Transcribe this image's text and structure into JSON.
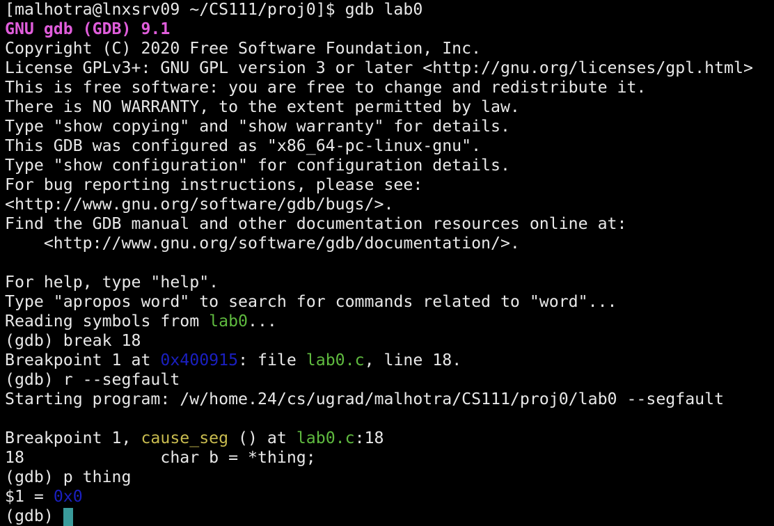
{
  "colors": {
    "background": "#000000",
    "default": "#e8e8e8",
    "banner": "#e05ddb",
    "filename": "#5fba3f",
    "function": "#c8bb4f",
    "address": "#1a1fbf",
    "cursor": "#3a9b9b"
  },
  "terminal": {
    "lines": [
      [
        {
          "t": "[malhotra@lnxsrv09 ~/CS111/proj0]$ gdb lab0"
        }
      ],
      [
        {
          "t": "GNU gdb (GDB) 9.1",
          "c": "banner",
          "b": true
        }
      ],
      [
        {
          "t": "Copyright (C) 2020 Free Software Foundation, Inc."
        }
      ],
      [
        {
          "t": "License GPLv3+: GNU GPL version 3 or later <http://gnu.org/licenses/gpl.html>"
        }
      ],
      [
        {
          "t": "This is free software: you are free to change and redistribute it."
        }
      ],
      [
        {
          "t": "There is NO WARRANTY, to the extent permitted by law."
        }
      ],
      [
        {
          "t": "Type \"show copying\" and \"show warranty\" for details."
        }
      ],
      [
        {
          "t": "This GDB was configured as \"x86_64-pc-linux-gnu\"."
        }
      ],
      [
        {
          "t": "Type \"show configuration\" for configuration details."
        }
      ],
      [
        {
          "t": "For bug reporting instructions, please see:"
        }
      ],
      [
        {
          "t": "<http://www.gnu.org/software/gdb/bugs/>."
        }
      ],
      [
        {
          "t": "Find the GDB manual and other documentation resources online at:"
        }
      ],
      [
        {
          "t": "    <http://www.gnu.org/software/gdb/documentation/>."
        }
      ],
      [
        {
          "t": ""
        }
      ],
      [
        {
          "t": "For help, type \"help\"."
        }
      ],
      [
        {
          "t": "Type \"apropos word\" to search for commands related to \"word\"..."
        }
      ],
      [
        {
          "t": "Reading symbols from "
        },
        {
          "t": "lab0",
          "c": "filename"
        },
        {
          "t": "..."
        }
      ],
      [
        {
          "t": "(gdb) break 18"
        }
      ],
      [
        {
          "t": "Breakpoint 1 at "
        },
        {
          "t": "0x400915",
          "c": "address"
        },
        {
          "t": ": file "
        },
        {
          "t": "lab0.c",
          "c": "filename"
        },
        {
          "t": ", line 18."
        }
      ],
      [
        {
          "t": "(gdb) r --segfault"
        }
      ],
      [
        {
          "t": "Starting program: /w/home.24/cs/ugrad/malhotra/CS111/proj0/lab0 --segfault"
        }
      ],
      [
        {
          "t": ""
        }
      ],
      [
        {
          "t": "Breakpoint 1, "
        },
        {
          "t": "cause_seg",
          "c": "function"
        },
        {
          "t": " () at "
        },
        {
          "t": "lab0.c",
          "c": "filename"
        },
        {
          "t": ":18"
        }
      ],
      [
        {
          "t": "18\t\tchar b = *thing;"
        }
      ],
      [
        {
          "t": "(gdb) p thing"
        }
      ],
      [
        {
          "t": "$1 = "
        },
        {
          "t": "0x0",
          "c": "address"
        }
      ],
      [
        {
          "t": "(gdb) "
        },
        {
          "cursor": true
        }
      ]
    ]
  }
}
